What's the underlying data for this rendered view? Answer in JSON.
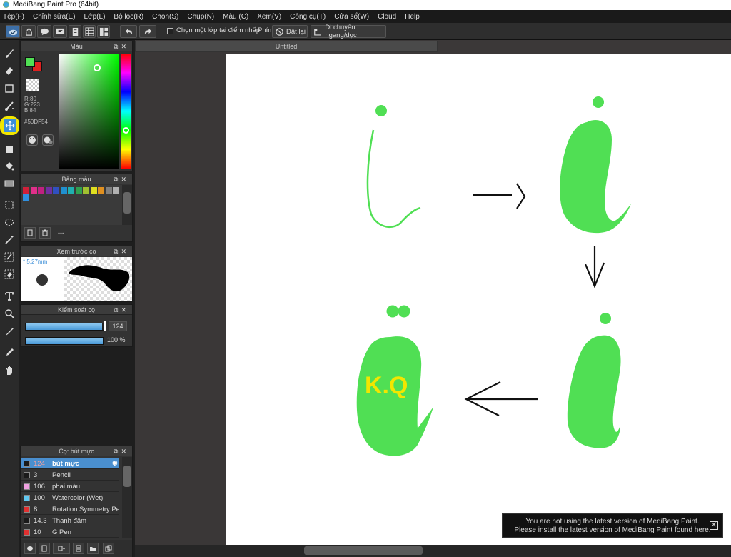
{
  "window": {
    "title": "MediBang Paint Pro (64bit)"
  },
  "menu": [
    "Tệp(F)",
    "Chỉnh sửa(E)",
    "Lớp(L)",
    "Bộ lọc(R)",
    "Chọn(S)",
    "Chụp(N)",
    "Màu (C)",
    "Xem(V)",
    "Công cụ(T)",
    "Cửa sổ(W)",
    "Cloud",
    "Help"
  ],
  "toolbar": {
    "checkbox_label": "Chọn một lớp tại điểm nhấp",
    "key_label": "Phím",
    "reset_label": "Đặt lại",
    "move_label": "Di chuyển ngang/dọc"
  },
  "color_panel": {
    "title": "Màu",
    "r": "R:80",
    "g": "G:223",
    "b": "B:84",
    "hex": "#50DF54",
    "fg_color": "#50DF54",
    "bg_color": "#E02020"
  },
  "palette_panel": {
    "title": "Bảng màu",
    "colors": [
      "#d0203a",
      "#e0308a",
      "#c02080",
      "#7030a0",
      "#3050c0",
      "#2090d0",
      "#20b0b0",
      "#30a050",
      "#a0c030",
      "#e0e020",
      "#e09020",
      "#808080",
      "#b0b0b0",
      "#3090e0"
    ],
    "count_label": "---"
  },
  "brush_preview": {
    "title": "Xem trước cọ",
    "size": "* 5.27mm"
  },
  "brush_control": {
    "title": "Kiểm soát cọ",
    "size_value": "124",
    "opacity_value": "100 %",
    "size_fraction": 0.97,
    "opacity_fraction": 1.0
  },
  "brush_list": {
    "title": "Cọ: bút mực",
    "items": [
      {
        "size": "124",
        "name": "bút mực",
        "color": "#1a1a1a",
        "selected": true
      },
      {
        "size": "3",
        "name": "Pencil",
        "color": "#1a1a1a"
      },
      {
        "size": "106",
        "name": "phai màu",
        "color": "#f0a0e0"
      },
      {
        "size": "100",
        "name": "Watercolor (Wet)",
        "color": "#60c8f0"
      },
      {
        "size": "8",
        "name": "Rotation Symmetry Pe",
        "color": "#e03030"
      },
      {
        "size": "14.3",
        "name": "Thanh đậm",
        "color": "#1a1a1a"
      },
      {
        "size": "10",
        "name": "G Pen",
        "color": "#e03030"
      }
    ]
  },
  "document": {
    "tab": "Untitled",
    "drawing_text": "K.Q",
    "drawing_green": "#50DF54",
    "drawing_yellow": "#F2E600"
  },
  "notification": {
    "line1": "You are not using the latest version of MediBang Paint.",
    "line2": "Please install the latest version of MediBang Paint found here.",
    "close": "✕"
  },
  "tool_icons": [
    "brush-icon",
    "eraser-icon",
    "rectangle-icon",
    "dot-brush-icon",
    "move-icon",
    "fill-rect-icon",
    "bucket-icon",
    "gradient-icon",
    "select-rect-icon",
    "lasso-icon",
    "magic-wand-icon",
    "select-pen-icon",
    "select-eraser-icon",
    "text-icon",
    "divide-icon",
    "eyedropper-pen-icon",
    "eyedropper-icon",
    "hand-icon"
  ]
}
